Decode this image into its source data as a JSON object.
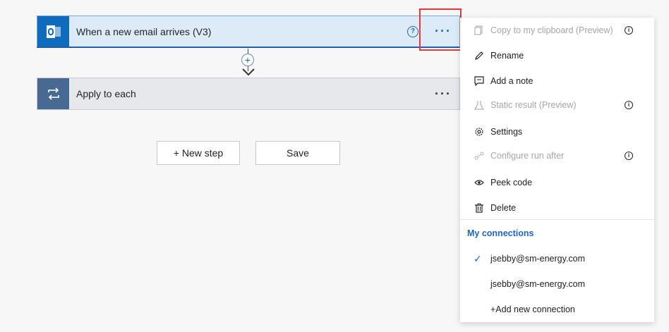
{
  "trigger": {
    "title": "When a new email arrives (V3)",
    "help": "?",
    "more": "···",
    "icon": "outlook-icon"
  },
  "connector": {
    "add": "+"
  },
  "apply": {
    "title": "Apply to each",
    "more": "···",
    "icon": "loop-icon"
  },
  "buttons": {
    "new_step": "+ New step",
    "save": "Save"
  },
  "menu": {
    "items": [
      {
        "label": "Copy to my clipboard (Preview)",
        "icon": "clipboard-icon",
        "disabled": true,
        "info": true
      },
      {
        "label": "Rename",
        "icon": "pencil-icon",
        "disabled": false,
        "info": false
      },
      {
        "label": "Add a note",
        "icon": "note-icon",
        "disabled": false,
        "info": false
      },
      {
        "label": "Static result (Preview)",
        "icon": "flask-icon",
        "disabled": true,
        "info": true
      },
      {
        "label": "Settings",
        "icon": "gear-icon",
        "disabled": false,
        "info": false
      },
      {
        "label": "Configure run after",
        "icon": "run-after-icon",
        "disabled": true,
        "info": true
      },
      {
        "label": "Peek code",
        "icon": "eye-icon",
        "disabled": false,
        "info": false
      },
      {
        "label": "Delete",
        "icon": "trash-icon",
        "disabled": false,
        "info": false
      }
    ],
    "info_glyph": "i",
    "section_title": "My connections",
    "connections": [
      {
        "label": "jsebby@sm-energy.com",
        "selected": true
      },
      {
        "label": "jsebby@sm-energy.com",
        "selected": false
      },
      {
        "label": "+Add new connection",
        "selected": false
      }
    ],
    "check_glyph": "✓"
  },
  "colors": {
    "accent": "#1f66bf",
    "trigger_bg": "#ddebf8",
    "highlight": "#e0393e"
  }
}
